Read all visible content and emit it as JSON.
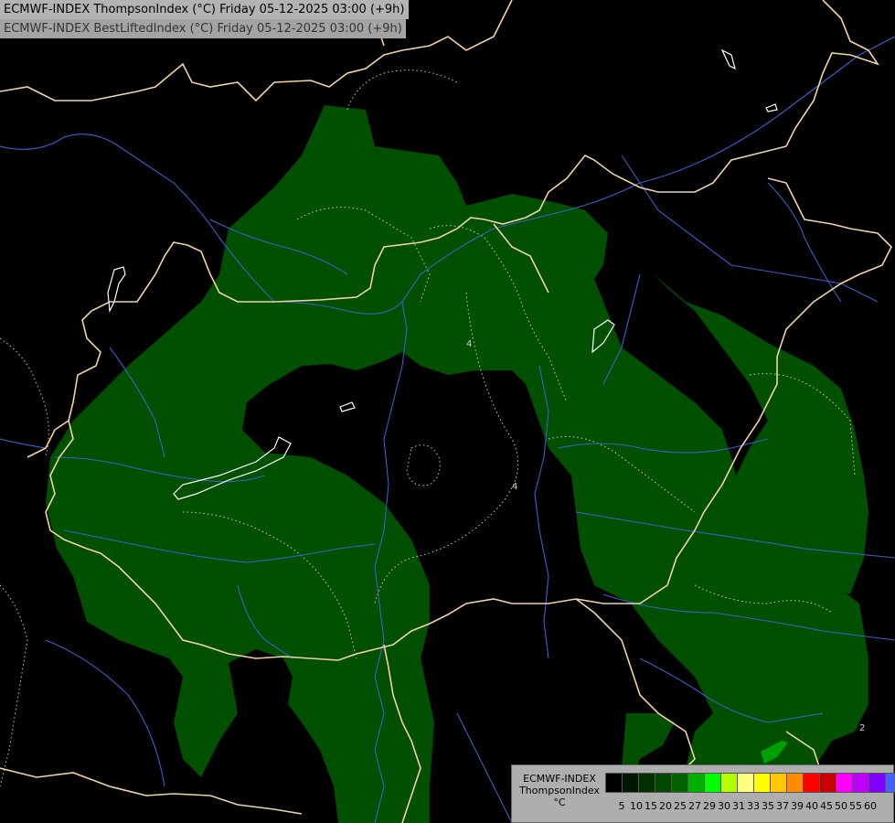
{
  "header": {
    "line1": "ECMWF-INDEX ThompsonIndex (°C) Friday 05-12-2025 03:00 (+9h)",
    "line2": "ECMWF-INDEX BestLiftedIndex (°C) Friday 05-12-2025 03:00 (+9h)"
  },
  "map": {
    "background_color": "#000000",
    "fill_color": "#005000",
    "highlight_color": "#00a000",
    "border_color": "#f2d3a6",
    "river_color": "#3a5fcd",
    "contour_labels": [
      "4",
      "4",
      "2"
    ]
  },
  "legend": {
    "title_lines": [
      "ECMWF-INDEX",
      "ThompsonIndex",
      "°C"
    ],
    "ticks": [
      "5",
      "10",
      "15",
      "20",
      "25",
      "27",
      "29",
      "30",
      "31",
      "33",
      "35",
      "37",
      "39",
      "40",
      "45",
      "50",
      "55",
      "60"
    ],
    "colors": [
      "#000000",
      "#001800",
      "#003000",
      "#004800",
      "#006400",
      "#00b000",
      "#00ff00",
      "#b4ff00",
      "#ffff80",
      "#ffff00",
      "#ffc800",
      "#ff8c00",
      "#ff0000",
      "#c80000",
      "#ff00ff",
      "#c000ff",
      "#8000ff",
      "#4060ff",
      "#0000ff"
    ]
  }
}
